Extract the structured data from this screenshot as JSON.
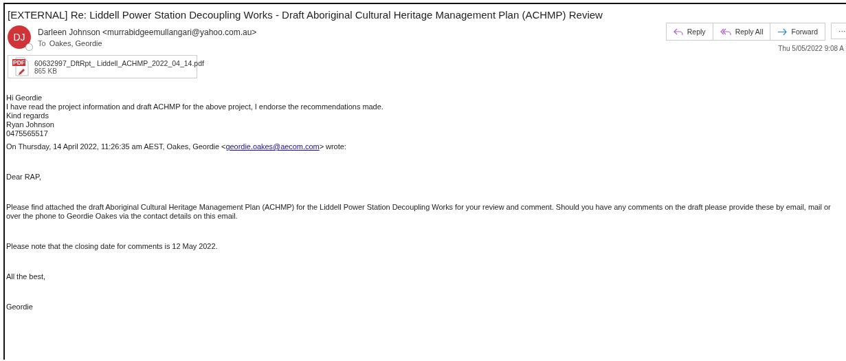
{
  "subject": "[EXTERNAL] Re: Liddell Power Station Decoupling Works - Draft Aboriginal Cultural Heritage Management Plan (ACHMP) Review",
  "sender": {
    "initials": "DJ",
    "from": "Darleen Johnson <murrabidgeemullangari@yahoo.com.au>",
    "to_label": "To",
    "to": "Oakes, Geordie"
  },
  "actions": [
    {
      "kind": "reply",
      "label": "Reply"
    },
    {
      "kind": "reply_all",
      "label": "Reply All"
    },
    {
      "kind": "forward",
      "label": "Forward"
    },
    {
      "kind": "more",
      "label": "···"
    }
  ],
  "timestamp": "Thu 5/05/2022 9:08 A",
  "attachment": {
    "name": "60632997_DftRpt_ Liddell_ACHMP_2022_04_14.pdf",
    "size": "865 KB",
    "icon_text": "PDF"
  },
  "body": [
    {
      "kind": "line",
      "text": "Hi Geordie"
    },
    {
      "kind": "line",
      "text": "I have read the project information and draft ACHMP for the above project, I endorse the recommendations made."
    },
    {
      "kind": "line",
      "text": "Kind regards"
    },
    {
      "kind": "line",
      "text": "Ryan Johnson"
    },
    {
      "kind": "line",
      "text": "0475565517"
    },
    {
      "kind": "gap"
    },
    {
      "kind": "quote_header",
      "before": "On Thursday, 14 April 2022, 11:26:35 am AEST, Oakes, Geordie <",
      "link": "geordie.oakes@aecom.com",
      "after": "> wrote:"
    },
    {
      "kind": "biggap"
    },
    {
      "kind": "line",
      "text": "Dear RAP,"
    },
    {
      "kind": "biggap"
    },
    {
      "kind": "line",
      "text": "Please find attached the draft Aboriginal Cultural Heritage Management Plan (ACHMP) for the Liddell Power Station Decoupling Works for your review and comment. Should you have any comments on the draft please provide these by email, mail or over the phone to Geordie Oakes via the contact details on this email."
    },
    {
      "kind": "biggap"
    },
    {
      "kind": "line",
      "text": "Please note that the closing date for comments is 12 May 2022."
    },
    {
      "kind": "biggap"
    },
    {
      "kind": "line",
      "text": "All the best,"
    },
    {
      "kind": "biggap"
    },
    {
      "kind": "line",
      "text": "Geordie"
    }
  ]
}
